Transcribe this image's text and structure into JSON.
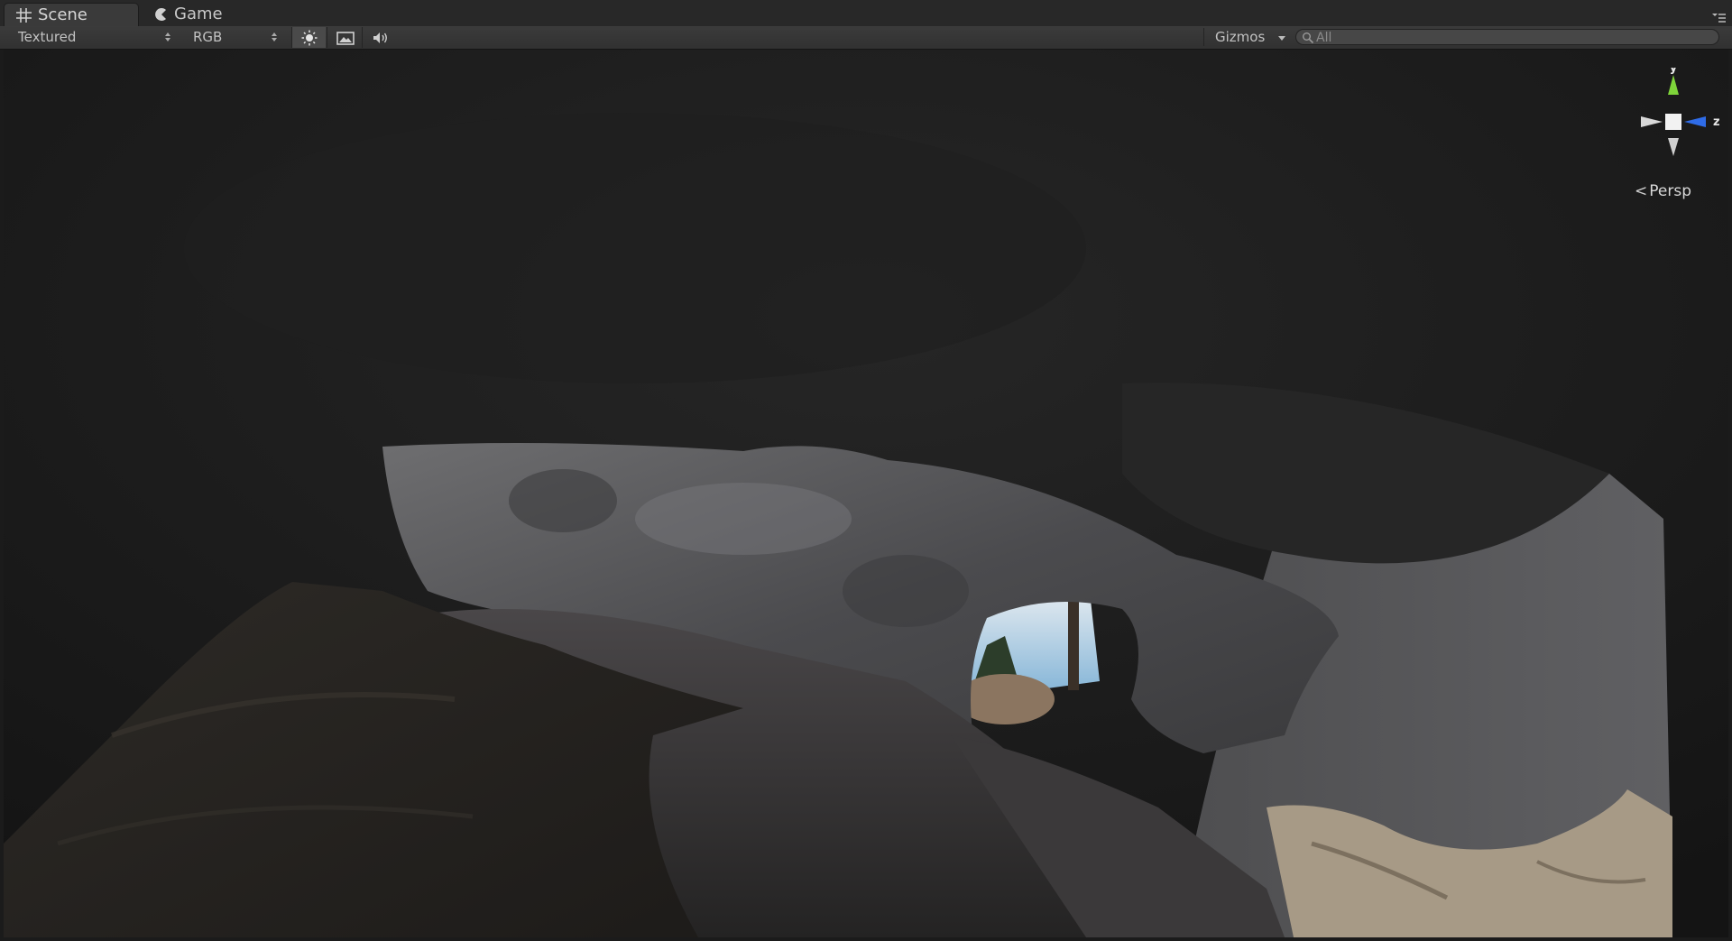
{
  "tabs": [
    {
      "label": "Scene",
      "icon": "grid-icon",
      "active": true
    },
    {
      "label": "Game",
      "icon": "pacman-icon",
      "active": false
    }
  ],
  "toolbar": {
    "render_mode": "Textured",
    "color_mode": "RGB",
    "lighting_icon": "sun-icon",
    "skybox_icon": "image-icon",
    "audio_icon": "speaker-icon",
    "gizmos_label": "Gizmos",
    "search_placeholder": "All"
  },
  "viewport": {
    "axes": {
      "y": "y",
      "z": "z"
    },
    "projection": "Persp"
  },
  "colors": {
    "tab_bg": "#282828",
    "toolbar_bg": "#363636",
    "gizmo_y": "#7ed43a",
    "gizmo_z": "#2f6ce8",
    "gizmo_neutral": "#d8d8d8"
  }
}
